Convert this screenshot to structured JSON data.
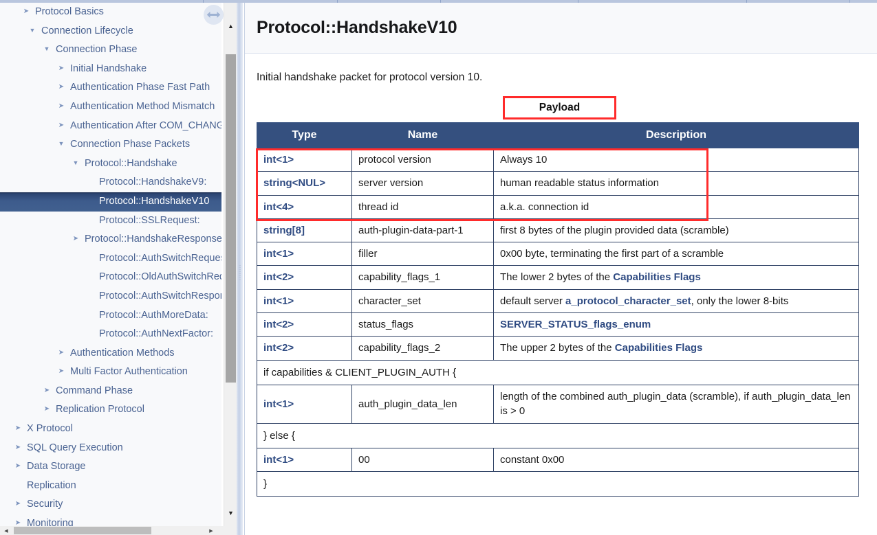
{
  "window": {
    "top_strip_ticks": [
      295,
      490,
      640,
      840,
      1085,
      1235
    ]
  },
  "sidebar": {
    "scrollbar": {
      "up_arrow_icon": "caret-up-icon",
      "down_arrow_icon": "caret-down-icon",
      "left_arrow_icon": "caret-left-icon",
      "right_arrow_icon": "caret-right-icon"
    },
    "resize_handle_icon": "left-right-arrow-icon",
    "items": [
      {
        "label": "Protocol Basics",
        "indent": 30,
        "twisty": "collapsed",
        "selected": false
      },
      {
        "label": "Connection Lifecycle",
        "indent": 39,
        "twisty": "expanded",
        "selected": false
      },
      {
        "label": "Connection Phase",
        "indent": 60,
        "twisty": "expanded",
        "selected": false
      },
      {
        "label": "Initial Handshake",
        "indent": 81,
        "twisty": "collapsed",
        "selected": false
      },
      {
        "label": "Authentication Phase Fast Path",
        "indent": 81,
        "twisty": "collapsed",
        "selected": false
      },
      {
        "label": "Authentication Method Mismatch",
        "indent": 81,
        "twisty": "collapsed",
        "selected": false
      },
      {
        "label": "Authentication After COM_CHANGE",
        "indent": 81,
        "twisty": "collapsed",
        "selected": false
      },
      {
        "label": "Connection Phase Packets",
        "indent": 81,
        "twisty": "expanded",
        "selected": false
      },
      {
        "label": "Protocol::Handshake",
        "indent": 102,
        "twisty": "expanded",
        "selected": false
      },
      {
        "label": "Protocol::HandshakeV9:",
        "indent": 123,
        "twisty": "none",
        "selected": false
      },
      {
        "label": "Protocol::HandshakeV10",
        "indent": 123,
        "twisty": "none",
        "selected": true
      },
      {
        "label": "Protocol::SSLRequest:",
        "indent": 123,
        "twisty": "none",
        "selected": false
      },
      {
        "label": "Protocol::HandshakeResponse",
        "indent": 102,
        "twisty": "collapsed",
        "selected": false
      },
      {
        "label": "Protocol::AuthSwitchRequest:",
        "indent": 123,
        "twisty": "none",
        "selected": false
      },
      {
        "label": "Protocol::OldAuthSwitchRequest",
        "indent": 123,
        "twisty": "none",
        "selected": false
      },
      {
        "label": "Protocol::AuthSwitchResponse",
        "indent": 123,
        "twisty": "none",
        "selected": false
      },
      {
        "label": "Protocol::AuthMoreData:",
        "indent": 123,
        "twisty": "none",
        "selected": false
      },
      {
        "label": "Protocol::AuthNextFactor:",
        "indent": 123,
        "twisty": "none",
        "selected": false
      },
      {
        "label": "Authentication Methods",
        "indent": 81,
        "twisty": "collapsed",
        "selected": false
      },
      {
        "label": "Multi Factor Authentication",
        "indent": 81,
        "twisty": "collapsed",
        "selected": false
      },
      {
        "label": "Command Phase",
        "indent": 60,
        "twisty": "collapsed",
        "selected": false
      },
      {
        "label": "Replication Protocol",
        "indent": 60,
        "twisty": "collapsed",
        "selected": false
      },
      {
        "label": "X Protocol",
        "indent": 18,
        "twisty": "collapsed",
        "selected": false
      },
      {
        "label": "SQL Query Execution",
        "indent": 18,
        "twisty": "collapsed",
        "selected": false
      },
      {
        "label": "Data Storage",
        "indent": 18,
        "twisty": "collapsed",
        "selected": false
      },
      {
        "label": "Replication",
        "indent": 18,
        "twisty": "none",
        "selected": false
      },
      {
        "label": "Security",
        "indent": 18,
        "twisty": "collapsed",
        "selected": false
      },
      {
        "label": "Monitoring",
        "indent": 18,
        "twisty": "collapsed",
        "selected": false
      }
    ]
  },
  "main": {
    "title": "Protocol::HandshakeV10",
    "intro": "Initial handshake packet for protocol version 10.",
    "payload_label": "Payload",
    "colors": {
      "annotation": "#ff2b2b",
      "table_header_bg": "#35507f",
      "link": "#2f4b82",
      "selection_bg": "#3d5b8c"
    },
    "table": {
      "headers": [
        "Type",
        "Name",
        "Description"
      ],
      "rows": [
        {
          "kind": "data",
          "type": "int<1>",
          "name": "protocol version",
          "desc": "Always 10"
        },
        {
          "kind": "data",
          "type": "string<NUL>",
          "name": "server version",
          "desc": "human readable status information"
        },
        {
          "kind": "data",
          "type": "int<4>",
          "name": "thread id",
          "desc": "a.k.a. connection id"
        },
        {
          "kind": "data",
          "type": "string[8]",
          "name": "auth-plugin-data-part-1",
          "desc": "first 8 bytes of the plugin provided data (scramble)"
        },
        {
          "kind": "data",
          "type": "int<1>",
          "name": "filler",
          "desc": "0x00 byte, terminating the first part of a scramble"
        },
        {
          "kind": "data",
          "type": "int<2>",
          "name": "capability_flags_1",
          "desc_parts": [
            {
              "t": "The lower 2 bytes of the ",
              "link": false
            },
            {
              "t": "Capabilities Flags",
              "link": true
            }
          ]
        },
        {
          "kind": "data",
          "type": "int<1>",
          "name": "character_set",
          "desc_parts": [
            {
              "t": "default server ",
              "link": false
            },
            {
              "t": "a_protocol_character_set",
              "link": true
            },
            {
              "t": ", only the lower 8-bits",
              "link": false
            }
          ]
        },
        {
          "kind": "data",
          "type": "int<2>",
          "name": "status_flags",
          "desc_parts": [
            {
              "t": "SERVER_STATUS_flags_enum",
              "link": true
            }
          ]
        },
        {
          "kind": "data",
          "type": "int<2>",
          "name": "capability_flags_2",
          "desc_parts": [
            {
              "t": "The upper 2 bytes of the ",
              "link": false
            },
            {
              "t": "Capabilities Flags",
              "link": true
            }
          ]
        },
        {
          "kind": "block",
          "text": "if capabilities & CLIENT_PLUGIN_AUTH {"
        },
        {
          "kind": "data",
          "type": "int<1>",
          "name": "auth_plugin_data_len",
          "desc": "length of the combined auth_plugin_data (scramble), if auth_plugin_data_len is > 0"
        },
        {
          "kind": "block",
          "text": "} else {"
        },
        {
          "kind": "data",
          "type": "int<1>",
          "name": "00",
          "desc": "constant 0x00"
        },
        {
          "kind": "block",
          "text": "}"
        }
      ]
    }
  }
}
